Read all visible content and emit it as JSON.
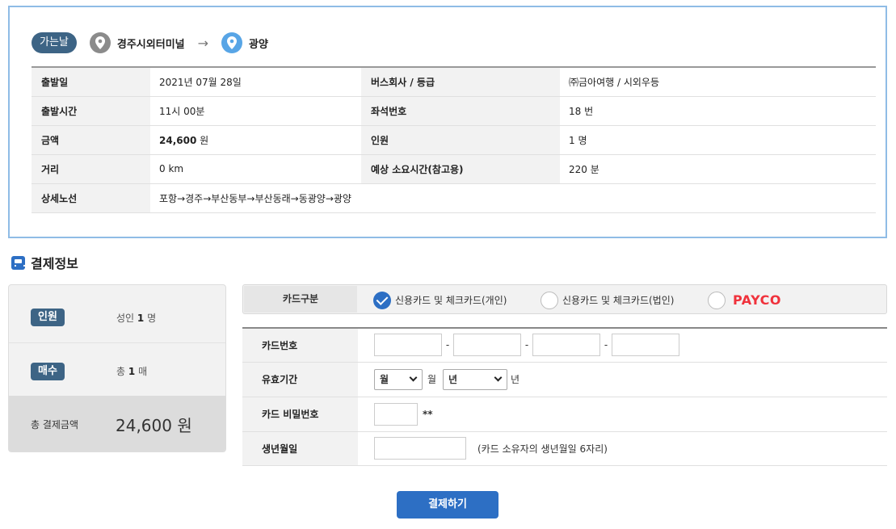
{
  "trip": {
    "badge": "가는날",
    "from": "경주시외터미널",
    "arrow": "→",
    "to": "광양",
    "rows": [
      {
        "l1": "출발일",
        "v1": "2021년 07월 28일",
        "l2": "버스회사 / 등급",
        "v2": "㈜금아여행 / 시외우등"
      },
      {
        "l1": "출발시간",
        "v1": "11시 00분",
        "l2": "좌석번호",
        "v2": "18 번"
      },
      {
        "l1": "금액",
        "v1": "24,600",
        "v1_unit": "원",
        "l2": "인원",
        "v2": "1 명"
      },
      {
        "l1": "거리",
        "v1": "0 km",
        "l2": "예상 소요시간(참고용)",
        "v2": "220 분"
      },
      {
        "l1": "상세노선",
        "v1": "포항→경주→부산동부→부산동래→동광양→광양"
      }
    ]
  },
  "payment": {
    "title": "결제정보",
    "summary": {
      "people_label": "인원",
      "people_prefix": "성인",
      "people_count": "1",
      "people_unit": "명",
      "count_label": "매수",
      "count_prefix": "총",
      "count_value": "1",
      "count_unit": "매",
      "total_label": "총 결제금액",
      "total_value": "24,600 원"
    },
    "card_type": {
      "label": "카드구분",
      "options": [
        {
          "label": "신용카드 및 체크카드(개인)",
          "selected": true
        },
        {
          "label": "신용카드 및 체크카드(법인)",
          "selected": false
        },
        {
          "label": "PAYCO",
          "selected": false
        }
      ]
    },
    "form": {
      "card_number_label": "카드번호",
      "card_sep": "-",
      "expiry_label": "유효기간",
      "month_select": "월",
      "month_unit": "월",
      "year_select": "년",
      "year_unit": "년",
      "pin_label": "카드 비밀번호",
      "pin_suffix": "**",
      "birth_label": "생년월일",
      "birth_hint": "(카드 소유자의 생년월일 6자리)"
    },
    "submit_label": "결제하기"
  },
  "colors": {
    "accent": "#2d6fc4",
    "badge": "#3d6485",
    "border": "#8fbce6",
    "payco": "#f0323c"
  }
}
